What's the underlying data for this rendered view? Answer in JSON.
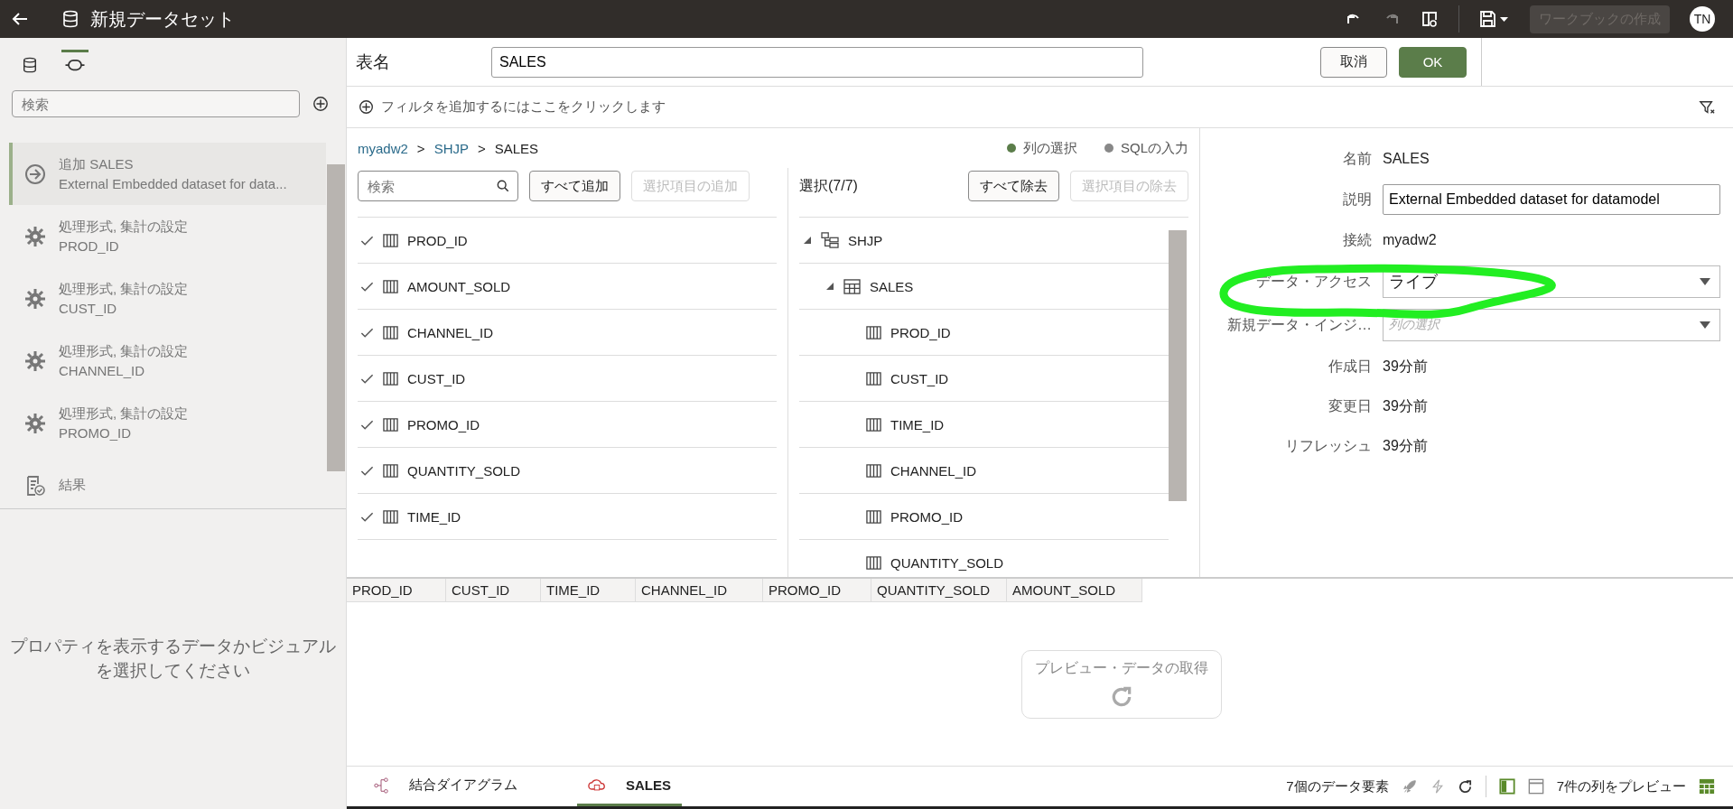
{
  "header": {
    "title": "新規データセット",
    "redo_disabled": true,
    "create_button": {
      "label": "ワークブックの作成",
      "disabled": true
    },
    "avatar": "TN"
  },
  "sidebar": {
    "tabs": [
      {
        "kind": "database",
        "selected": false
      },
      {
        "kind": "join",
        "selected": true
      }
    ],
    "search": {
      "placeholder": "検索"
    },
    "steps": [
      {
        "kind": "add",
        "title": "追加 SALES",
        "subtitle": "External Embedded dataset for data...",
        "selected": true
      },
      {
        "kind": "transform",
        "title": "処理形式, 集計の設定",
        "subtitle": "PROD_ID",
        "selected": false
      },
      {
        "kind": "transform",
        "title": "処理形式, 集計の設定",
        "subtitle": "CUST_ID",
        "selected": false
      },
      {
        "kind": "transform",
        "title": "処理形式, 集計の設定",
        "subtitle": "CHANNEL_ID",
        "selected": false
      },
      {
        "kind": "transform",
        "title": "処理形式, 集計の設定",
        "subtitle": "PROMO_ID",
        "selected": false
      },
      {
        "kind": "result",
        "title": "結果",
        "selected": false
      }
    ],
    "empty_message": "プロパティを表示するデータかビジュアルを選択してください"
  },
  "table_name": {
    "label": "表名",
    "value": "SALES"
  },
  "buttons": [
    {
      "kind": "secondary",
      "label": "取消"
    },
    {
      "kind": "primary",
      "label": "OK"
    }
  ],
  "filter_bar": {
    "text": "フィルタを追加するにはここをクリックします"
  },
  "breadcrumb": {
    "items": [
      "myadw2",
      "SHJP",
      "SALES"
    ],
    "separator": ">"
  },
  "modes": [
    {
      "label": "列の選択",
      "selected": true
    },
    {
      "label": "SQLの入力",
      "selected": false
    }
  ],
  "available": {
    "search": {
      "placeholder": "検索"
    },
    "add_all": {
      "label": "すべて追加",
      "disabled": false
    },
    "add_selected": {
      "label": "選択項目の追加",
      "disabled": true
    },
    "columns": [
      {
        "name": "PROD_ID",
        "checked": true
      },
      {
        "name": "AMOUNT_SOLD",
        "checked": true
      },
      {
        "name": "CHANNEL_ID",
        "checked": true
      },
      {
        "name": "CUST_ID",
        "checked": true
      },
      {
        "name": "PROMO_ID",
        "checked": true
      },
      {
        "name": "QUANTITY_SOLD",
        "checked": true
      },
      {
        "name": "TIME_ID",
        "checked": true
      }
    ]
  },
  "selected": {
    "title": "選択(7/7)",
    "remove_all": {
      "label": "すべて除去",
      "disabled": false
    },
    "remove_selected": {
      "label": "選択項目の除去",
      "disabled": true
    },
    "tree": [
      {
        "kind": "schema",
        "label": "SHJP",
        "expanded": true,
        "children": [
          {
            "kind": "table",
            "label": "SALES",
            "expanded": true,
            "children": [
              {
                "kind": "column",
                "label": "PROD_ID"
              },
              {
                "kind": "column",
                "label": "CUST_ID"
              },
              {
                "kind": "column",
                "label": "TIME_ID"
              },
              {
                "kind": "column",
                "label": "CHANNEL_ID"
              },
              {
                "kind": "column",
                "label": "PROMO_ID"
              },
              {
                "kind": "column",
                "label": "QUANTITY_SOLD"
              }
            ]
          }
        ]
      }
    ]
  },
  "properties": [
    {
      "kind": "text",
      "label": "名前",
      "value": "SALES"
    },
    {
      "kind": "input",
      "label": "説明",
      "value": "External Embedded dataset for datamodel"
    },
    {
      "kind": "text",
      "label": "接続",
      "value": "myadw2"
    },
    {
      "kind": "select",
      "label": "データ・アクセス",
      "value": "ライブ"
    },
    {
      "kind": "select",
      "label": "新規データ・インジ…",
      "placeholder": "列の選択"
    },
    {
      "kind": "text",
      "label": "作成日",
      "value": "39分前"
    },
    {
      "kind": "text",
      "label": "変更日",
      "value": "39分前"
    },
    {
      "kind": "text",
      "label": "リフレッシュ",
      "value": "39分前"
    }
  ],
  "preview": {
    "columns": [
      "PROD_ID",
      "CUST_ID",
      "TIME_ID",
      "CHANNEL_ID",
      "PROMO_ID",
      "QUANTITY_SOLD",
      "AMOUNT_SOLD"
    ],
    "fetch_button": "プレビュー・データの取得"
  },
  "bottom_bar": {
    "tabs": [
      {
        "kind": "diagram",
        "label": "結合ダイアグラム",
        "selected": false
      },
      {
        "kind": "dataset",
        "label": "SALES",
        "selected": true
      }
    ],
    "element_count": "7個のデータ要素",
    "preview_count": "7件の列をプレビュー"
  }
}
